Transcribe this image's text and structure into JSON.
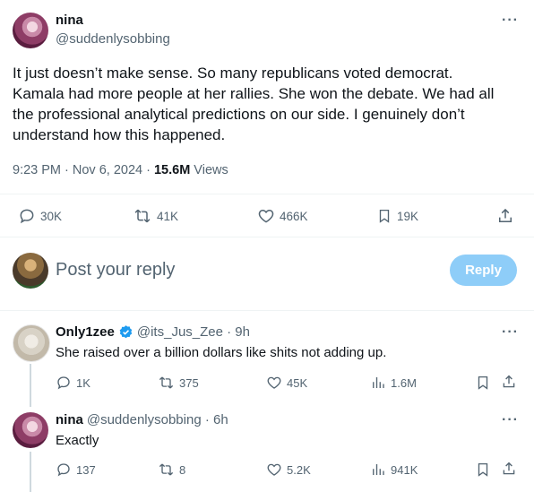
{
  "main_post": {
    "display_name": "nina",
    "handle": "@suddenlysobbing",
    "text_lines": [
      "It just doesn’t make sense. So many republicans voted democrat.",
      "Kamala had more people at her rallies. She won the debate. We had all",
      "the professional analytical predictions on our side. I genuinely don’t",
      "understand how this happened."
    ],
    "time": "9:23 PM · Nov 6, 2024 · ",
    "views_count": "15.6M",
    "views_label": " Views",
    "stats": {
      "replies": "30K",
      "reposts": "41K",
      "likes": "466K",
      "bookmarks": "19K"
    }
  },
  "composer": {
    "placeholder": "Post your reply",
    "button_label": "Reply"
  },
  "replies": [
    {
      "display_name": "Only1zee",
      "handle": "@its_Jus_Zee · 9h",
      "text": "She raised over a billion dollars like shits not adding up.",
      "stats": {
        "replies": "1K",
        "reposts": "375",
        "likes": "45K",
        "views": "1.6M"
      }
    },
    {
      "display_name": "nina",
      "handle": "@suddenlysobbing · 6h",
      "text": "Exactly",
      "stats": {
        "replies": "137",
        "reposts": "8",
        "likes": "5.2K",
        "views": "941K"
      }
    }
  ],
  "colors": {
    "accent": "#1d9bf0",
    "muted": "#536471",
    "reply_button": "#8ecdf8"
  },
  "more_glyph": "···"
}
